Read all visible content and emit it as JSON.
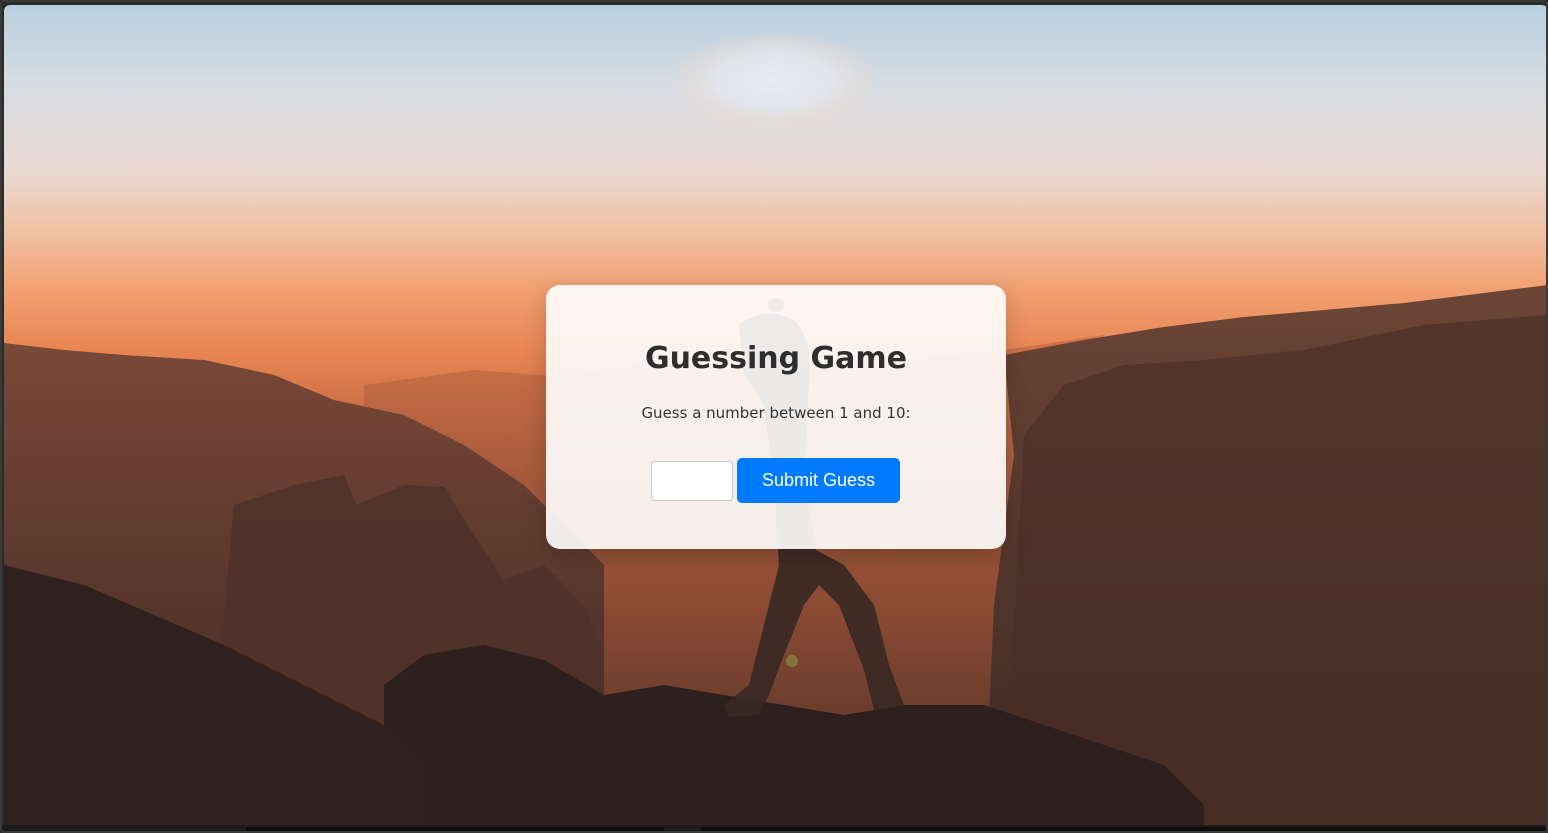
{
  "game": {
    "title": "Guessing Game",
    "prompt": "Guess a number between 1 and 10:",
    "input_value": "",
    "input_placeholder": "",
    "submit_label": "Submit Guess"
  },
  "colors": {
    "button": "#007bff",
    "card_background": "#ffffff",
    "title_text": "#2e2e2e"
  },
  "background": {
    "description_icon": "mountain-sunset-hiker-photo"
  }
}
